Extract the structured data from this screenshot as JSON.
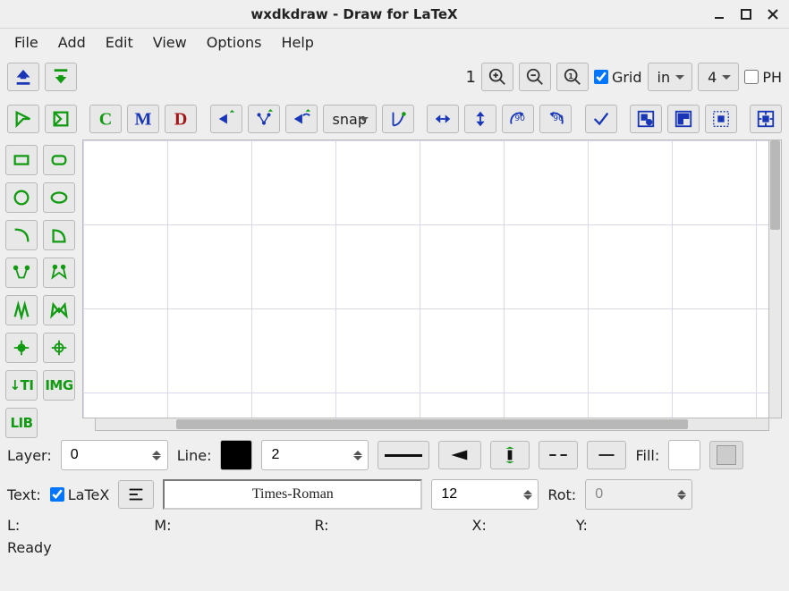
{
  "window": {
    "title": "wxdkdraw - Draw for LaTeX"
  },
  "menu": {
    "file": "File",
    "add": "Add",
    "edit": "Edit",
    "view": "View",
    "options": "Options",
    "help": "Help"
  },
  "toolbar1": {
    "zoom_value": "1",
    "grid_label": "Grid",
    "grid_checked": true,
    "grid_unit": "in",
    "grid_sub": "4",
    "ph_label": "PH",
    "ph_checked": false
  },
  "toolbar2": {
    "snap_label": "snap"
  },
  "palette": {
    "lib_label": "LIB",
    "img_label": "IMG",
    "ti_label": "TI"
  },
  "bottom": {
    "layer_label": "Layer:",
    "layer_value": "0",
    "line_label": "Line:",
    "line_color": "#000000",
    "line_width": "2",
    "fill_label": "Fill:",
    "fill_color": "#ffffff",
    "text_label": "Text:",
    "latex_label": "LaTeX",
    "latex_checked": true,
    "font_name": "Times-Roman",
    "font_size": "12",
    "rot_label": "Rot:",
    "rot_value": "0"
  },
  "status": {
    "l": "L:",
    "m": "M:",
    "r": "R:",
    "x": "X:",
    "y": "Y:",
    "ready": "Ready"
  }
}
